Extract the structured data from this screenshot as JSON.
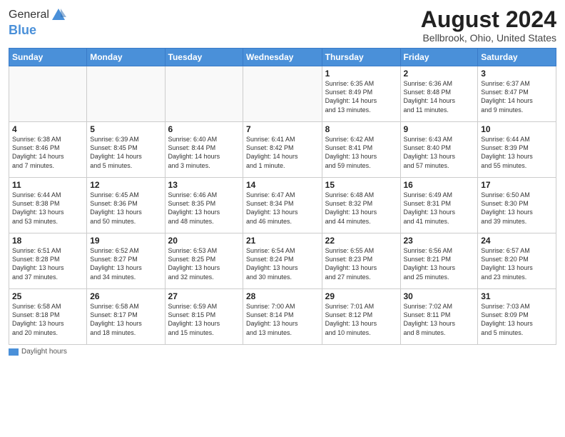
{
  "logo": {
    "general": "General",
    "blue": "Blue"
  },
  "title": "August 2024",
  "location": "Bellbrook, Ohio, United States",
  "weekdays": [
    "Sunday",
    "Monday",
    "Tuesday",
    "Wednesday",
    "Thursday",
    "Friday",
    "Saturday"
  ],
  "weeks": [
    [
      {
        "day": "",
        "info": ""
      },
      {
        "day": "",
        "info": ""
      },
      {
        "day": "",
        "info": ""
      },
      {
        "day": "",
        "info": ""
      },
      {
        "day": "1",
        "info": "Sunrise: 6:35 AM\nSunset: 8:49 PM\nDaylight: 14 hours\nand 13 minutes."
      },
      {
        "day": "2",
        "info": "Sunrise: 6:36 AM\nSunset: 8:48 PM\nDaylight: 14 hours\nand 11 minutes."
      },
      {
        "day": "3",
        "info": "Sunrise: 6:37 AM\nSunset: 8:47 PM\nDaylight: 14 hours\nand 9 minutes."
      }
    ],
    [
      {
        "day": "4",
        "info": "Sunrise: 6:38 AM\nSunset: 8:46 PM\nDaylight: 14 hours\nand 7 minutes."
      },
      {
        "day": "5",
        "info": "Sunrise: 6:39 AM\nSunset: 8:45 PM\nDaylight: 14 hours\nand 5 minutes."
      },
      {
        "day": "6",
        "info": "Sunrise: 6:40 AM\nSunset: 8:44 PM\nDaylight: 14 hours\nand 3 minutes."
      },
      {
        "day": "7",
        "info": "Sunrise: 6:41 AM\nSunset: 8:42 PM\nDaylight: 14 hours\nand 1 minute."
      },
      {
        "day": "8",
        "info": "Sunrise: 6:42 AM\nSunset: 8:41 PM\nDaylight: 13 hours\nand 59 minutes."
      },
      {
        "day": "9",
        "info": "Sunrise: 6:43 AM\nSunset: 8:40 PM\nDaylight: 13 hours\nand 57 minutes."
      },
      {
        "day": "10",
        "info": "Sunrise: 6:44 AM\nSunset: 8:39 PM\nDaylight: 13 hours\nand 55 minutes."
      }
    ],
    [
      {
        "day": "11",
        "info": "Sunrise: 6:44 AM\nSunset: 8:38 PM\nDaylight: 13 hours\nand 53 minutes."
      },
      {
        "day": "12",
        "info": "Sunrise: 6:45 AM\nSunset: 8:36 PM\nDaylight: 13 hours\nand 50 minutes."
      },
      {
        "day": "13",
        "info": "Sunrise: 6:46 AM\nSunset: 8:35 PM\nDaylight: 13 hours\nand 48 minutes."
      },
      {
        "day": "14",
        "info": "Sunrise: 6:47 AM\nSunset: 8:34 PM\nDaylight: 13 hours\nand 46 minutes."
      },
      {
        "day": "15",
        "info": "Sunrise: 6:48 AM\nSunset: 8:32 PM\nDaylight: 13 hours\nand 44 minutes."
      },
      {
        "day": "16",
        "info": "Sunrise: 6:49 AM\nSunset: 8:31 PM\nDaylight: 13 hours\nand 41 minutes."
      },
      {
        "day": "17",
        "info": "Sunrise: 6:50 AM\nSunset: 8:30 PM\nDaylight: 13 hours\nand 39 minutes."
      }
    ],
    [
      {
        "day": "18",
        "info": "Sunrise: 6:51 AM\nSunset: 8:28 PM\nDaylight: 13 hours\nand 37 minutes."
      },
      {
        "day": "19",
        "info": "Sunrise: 6:52 AM\nSunset: 8:27 PM\nDaylight: 13 hours\nand 34 minutes."
      },
      {
        "day": "20",
        "info": "Sunrise: 6:53 AM\nSunset: 8:25 PM\nDaylight: 13 hours\nand 32 minutes."
      },
      {
        "day": "21",
        "info": "Sunrise: 6:54 AM\nSunset: 8:24 PM\nDaylight: 13 hours\nand 30 minutes."
      },
      {
        "day": "22",
        "info": "Sunrise: 6:55 AM\nSunset: 8:23 PM\nDaylight: 13 hours\nand 27 minutes."
      },
      {
        "day": "23",
        "info": "Sunrise: 6:56 AM\nSunset: 8:21 PM\nDaylight: 13 hours\nand 25 minutes."
      },
      {
        "day": "24",
        "info": "Sunrise: 6:57 AM\nSunset: 8:20 PM\nDaylight: 13 hours\nand 23 minutes."
      }
    ],
    [
      {
        "day": "25",
        "info": "Sunrise: 6:58 AM\nSunset: 8:18 PM\nDaylight: 13 hours\nand 20 minutes."
      },
      {
        "day": "26",
        "info": "Sunrise: 6:58 AM\nSunset: 8:17 PM\nDaylight: 13 hours\nand 18 minutes."
      },
      {
        "day": "27",
        "info": "Sunrise: 6:59 AM\nSunset: 8:15 PM\nDaylight: 13 hours\nand 15 minutes."
      },
      {
        "day": "28",
        "info": "Sunrise: 7:00 AM\nSunset: 8:14 PM\nDaylight: 13 hours\nand 13 minutes."
      },
      {
        "day": "29",
        "info": "Sunrise: 7:01 AM\nSunset: 8:12 PM\nDaylight: 13 hours\nand 10 minutes."
      },
      {
        "day": "30",
        "info": "Sunrise: 7:02 AM\nSunset: 8:11 PM\nDaylight: 13 hours\nand 8 minutes."
      },
      {
        "day": "31",
        "info": "Sunrise: 7:03 AM\nSunset: 8:09 PM\nDaylight: 13 hours\nand 5 minutes."
      }
    ]
  ],
  "legend": {
    "label": "Daylight hours"
  }
}
